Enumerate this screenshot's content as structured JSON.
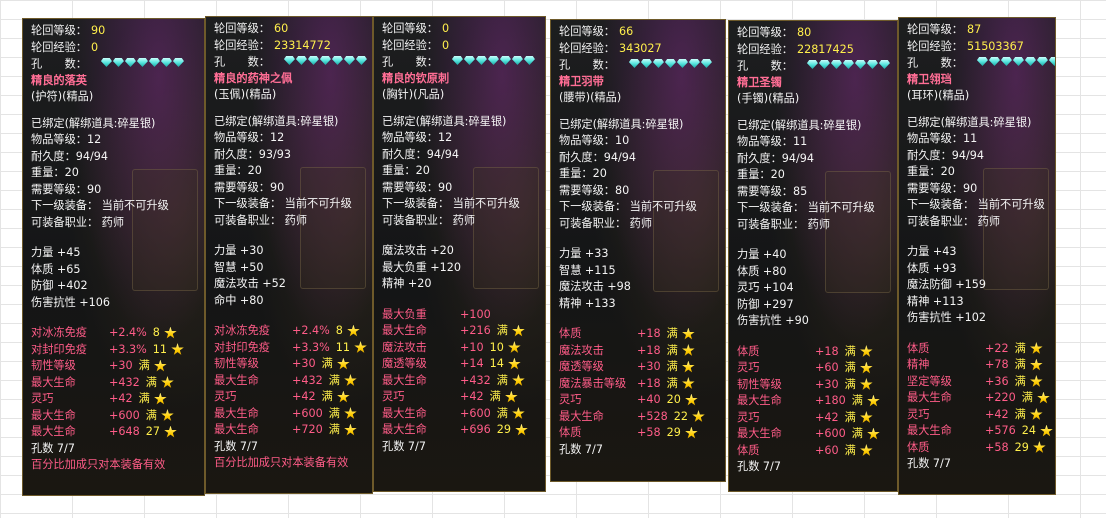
{
  "labels": {
    "rebirth_level": "轮回等级：",
    "rebirth_exp": "轮回经验：",
    "holes": "孔　　数：",
    "bound": "已绑定(解绑道具:碎星银)",
    "item_level": "物品等级：",
    "durability": "耐久度：",
    "weight": "重量：",
    "req_level": "需要等级：",
    "next_equip": "下一级装备：  当前不可升级",
    "job": "可装备职业：  药师"
  },
  "cards": [
    {
      "level": "90",
      "exp": "0",
      "name": "精良的落英",
      "type": "(护符)(精品)",
      "item_level": "12",
      "durability": "94/94",
      "weight": "20",
      "req_level": "90",
      "stats": [
        "力量 +45",
        "体质 +65",
        "防御 +402",
        "伤害抗性 +106"
      ],
      "affixes": [
        {
          "name": "对冰冻免疫",
          "val": "+2.4%",
          "tail": "8",
          "color": "pink",
          "star": true
        },
        {
          "name": "对封印免疫",
          "val": "+3.3%",
          "tail": "11",
          "color": "pink",
          "star": true
        },
        {
          "name": "韧性等级",
          "val": "+30",
          "tail": "满",
          "color": "pink",
          "star": true
        },
        {
          "name": "最大生命",
          "val": "+432",
          "tail": "满",
          "color": "pink",
          "star": true
        },
        {
          "name": "灵巧",
          "val": "+42",
          "tail": "满",
          "color": "pink",
          "star": true
        },
        {
          "name": "最大生命",
          "val": "+600",
          "tail": "满",
          "color": "pink",
          "star": true
        },
        {
          "name": "最大生命",
          "val": "+648",
          "tail": "27",
          "color": "pink",
          "star": true
        }
      ],
      "holes_line": "孔数 7/7",
      "note": "百分比加成只对本装备有效"
    },
    {
      "level": "60",
      "exp": "23314772",
      "name": "精良的药神之佩",
      "type": "(玉佩)(精品)",
      "item_level": "12",
      "durability": "93/93",
      "weight": "20",
      "req_level": "90",
      "stats": [
        "力量 +30",
        "智慧 +50",
        "魔法攻击 +52",
        "命中 +80"
      ],
      "affixes": [
        {
          "name": "对冰冻免疫",
          "val": "+2.4%",
          "tail": "8",
          "color": "pink",
          "star": true
        },
        {
          "name": "对封印免疫",
          "val": "+3.3%",
          "tail": "11",
          "color": "pink",
          "star": true
        },
        {
          "name": "韧性等级",
          "val": "+30",
          "tail": "满",
          "color": "pink",
          "star": true
        },
        {
          "name": "最大生命",
          "val": "+432",
          "tail": "满",
          "color": "pink",
          "star": true
        },
        {
          "name": "灵巧",
          "val": "+42",
          "tail": "满",
          "color": "pink",
          "star": true
        },
        {
          "name": "最大生命",
          "val": "+600",
          "tail": "满",
          "color": "pink",
          "star": true
        },
        {
          "name": "最大生命",
          "val": "+720",
          "tail": "满",
          "color": "pink",
          "star": true
        }
      ],
      "holes_line": "孔数 7/7",
      "note": "百分比加成只对本装备有效"
    },
    {
      "level": "0",
      "exp": "0",
      "name": "精良的钦原刺",
      "type": "(胸针)(凡品)",
      "item_level": "12",
      "durability": "94/94",
      "weight": "20",
      "req_level": "90",
      "stats": [
        "魔法攻击 +20",
        "最大负重 +120",
        "精神 +20"
      ],
      "affixes": [
        {
          "name": "最大负重",
          "val": "+100",
          "tail": "",
          "color": "pink",
          "star": false
        },
        {
          "name": "最大生命",
          "val": "+216",
          "tail": "满",
          "color": "pink",
          "star": true
        },
        {
          "name": "魔法攻击",
          "val": "+10",
          "tail": "10",
          "color": "pink",
          "star": true
        },
        {
          "name": "魔透等级",
          "val": "+14",
          "tail": "14",
          "color": "pink",
          "star": true
        },
        {
          "name": "最大生命",
          "val": "+432",
          "tail": "满",
          "color": "pink",
          "star": true
        },
        {
          "name": "灵巧",
          "val": "+42",
          "tail": "满",
          "color": "pink",
          "star": true
        },
        {
          "name": "最大生命",
          "val": "+600",
          "tail": "满",
          "color": "pink",
          "star": true
        },
        {
          "name": "最大生命",
          "val": "+696",
          "tail": "29",
          "color": "pink",
          "star": true
        }
      ],
      "holes_line": "孔数 7/7",
      "note": ""
    },
    {
      "level": "66",
      "exp": "343027",
      "name": "精卫羽带",
      "type": "(腰带)(精品)",
      "item_level": "10",
      "durability": "94/94",
      "weight": "20",
      "req_level": "80",
      "stats": [
        "力量 +33",
        "智慧 +115",
        "魔法攻击 +98",
        "精神 +133"
      ],
      "affixes": [
        {
          "name": "体质",
          "val": "+18",
          "tail": "满",
          "color": "pink",
          "star": true
        },
        {
          "name": "魔法攻击",
          "val": "+18",
          "tail": "满",
          "color": "pink",
          "star": true
        },
        {
          "name": "魔透等级",
          "val": "+30",
          "tail": "满",
          "color": "pink",
          "star": true
        },
        {
          "name": "魔法暴击等级",
          "val": "+18",
          "tail": "满",
          "color": "pink",
          "star": true
        },
        {
          "name": "灵巧",
          "val": "+40",
          "tail": "20",
          "color": "pink",
          "star": true
        },
        {
          "name": "最大生命",
          "val": "+528",
          "tail": "22",
          "color": "pink",
          "star": true
        },
        {
          "name": "体质",
          "val": "+58",
          "tail": "29",
          "color": "pink",
          "star": true
        }
      ],
      "holes_line": "孔数 7/7",
      "note": ""
    },
    {
      "level": "80",
      "exp": "22817425",
      "name": "精卫圣镯",
      "type": "(手镯)(精品)",
      "item_level": "11",
      "durability": "94/94",
      "weight": "20",
      "req_level": "85",
      "stats": [
        "力量 +40",
        "体质 +80",
        "灵巧 +104",
        "防御 +297",
        "伤害抗性 +90"
      ],
      "affixes": [
        {
          "name": "体质",
          "val": "+18",
          "tail": "满",
          "color": "pink",
          "star": true
        },
        {
          "name": "灵巧",
          "val": "+60",
          "tail": "满",
          "color": "pink",
          "star": true
        },
        {
          "name": "韧性等级",
          "val": "+30",
          "tail": "满",
          "color": "pink",
          "star": true
        },
        {
          "name": "最大生命",
          "val": "+180",
          "tail": "满",
          "color": "pink",
          "star": true
        },
        {
          "name": "灵巧",
          "val": "+42",
          "tail": "满",
          "color": "pink",
          "star": true
        },
        {
          "name": "最大生命",
          "val": "+600",
          "tail": "满",
          "color": "pink",
          "star": true
        },
        {
          "name": "体质",
          "val": "+60",
          "tail": "满",
          "color": "pink",
          "star": true
        }
      ],
      "holes_line": "孔数 7/7",
      "note": ""
    },
    {
      "level": "87",
      "exp": "51503367",
      "name": "精卫翎珰",
      "type": "(耳环)(精品)",
      "item_level": "11",
      "durability": "94/94",
      "weight": "20",
      "req_level": "90",
      "stats": [
        "力量 +43",
        "体质 +93",
        "魔法防御 +159",
        "精神 +113",
        "伤害抗性 +102"
      ],
      "affixes": [
        {
          "name": "体质",
          "val": "+22",
          "tail": "满",
          "color": "pink",
          "star": true
        },
        {
          "name": "精神",
          "val": "+78",
          "tail": "满",
          "color": "pink",
          "star": true
        },
        {
          "name": "坚定等级",
          "val": "+36",
          "tail": "满",
          "color": "pink",
          "star": true
        },
        {
          "name": "最大生命",
          "val": "+220",
          "tail": "满",
          "color": "pink",
          "star": true
        },
        {
          "name": "灵巧",
          "val": "+42",
          "tail": "满",
          "color": "pink",
          "star": true
        },
        {
          "name": "最大生命",
          "val": "+576",
          "tail": "24",
          "color": "pink",
          "star": true
        },
        {
          "name": "体质",
          "val": "+58",
          "tail": "29",
          "color": "pink",
          "star": true
        }
      ],
      "holes_line": "孔数 7/7",
      "note": ""
    }
  ]
}
